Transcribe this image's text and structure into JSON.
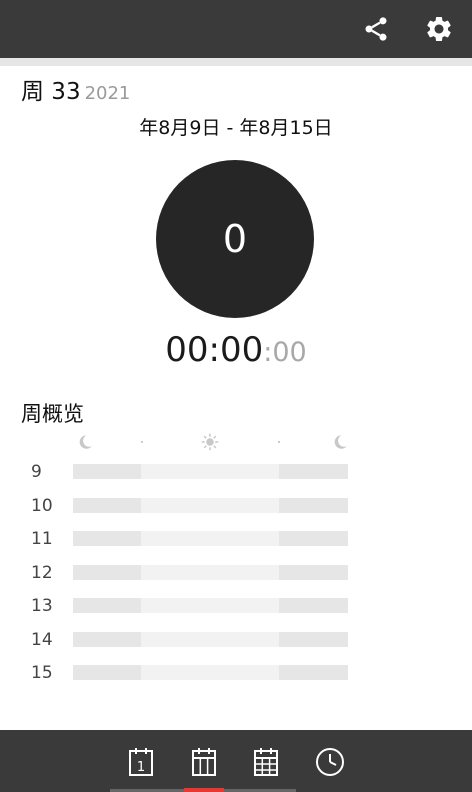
{
  "header": {
    "share_icon": "share-icon",
    "settings_icon": "gear-icon"
  },
  "week": {
    "label": "周 33",
    "year": "2021",
    "date_range": "年8月9日 - 年8月15日"
  },
  "summary": {
    "count": "0",
    "duration_main": "00:00",
    "duration_seconds": ":00"
  },
  "overview": {
    "title": "周概览",
    "header_icons": [
      "moon-icon",
      "sun-icon",
      "moon-icon"
    ],
    "rows": [
      {
        "label": "9"
      },
      {
        "label": "10"
      },
      {
        "label": "11"
      },
      {
        "label": "12"
      },
      {
        "label": "13"
      },
      {
        "label": "14"
      },
      {
        "label": "15"
      }
    ]
  },
  "nav": {
    "day_tab_number": "1",
    "tabs": [
      "calendar-day-icon",
      "calendar-week-icon",
      "calendar-month-icon",
      "clock-icon"
    ],
    "active_tab": 1
  },
  "colors": {
    "bar_bg": "#3a3a3a",
    "accent": "#e53935"
  }
}
